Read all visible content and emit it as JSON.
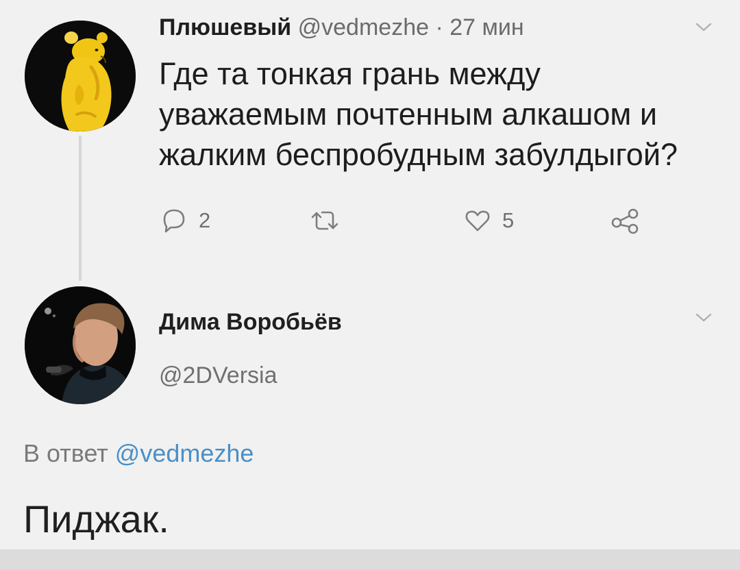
{
  "tweet": {
    "author_name": "Плюшевый",
    "handle": "@vedmezhe",
    "separator": "·",
    "time": "27 мин",
    "text_lines": [
      "Где та тонкая грань между",
      "уважаемым почтенным алкашом и",
      "жалким беспробудным забулдыгой?"
    ],
    "reply_count": "2",
    "like_count": "5"
  },
  "reply": {
    "author_name": "Дима Воробьёв",
    "handle": "@2DVersia",
    "reply_to_label": "В ответ",
    "reply_to_handle": "@vedmezhe",
    "text": "Пиджак."
  },
  "colors": {
    "background": "#f1f1f1",
    "text_primary": "#1d1d1d",
    "text_secondary": "#707070",
    "link_blue": "#4b8fc6",
    "thread_line": "#d6d6d6"
  },
  "icons": {
    "avatar_one": "winnie-bear-avatar",
    "avatar_two": "man-portrait-avatar",
    "menu": "chevron-down-icon",
    "reply": "reply-bubble-icon",
    "retweet": "retweet-icon",
    "like": "heart-icon",
    "share": "share-icon"
  }
}
